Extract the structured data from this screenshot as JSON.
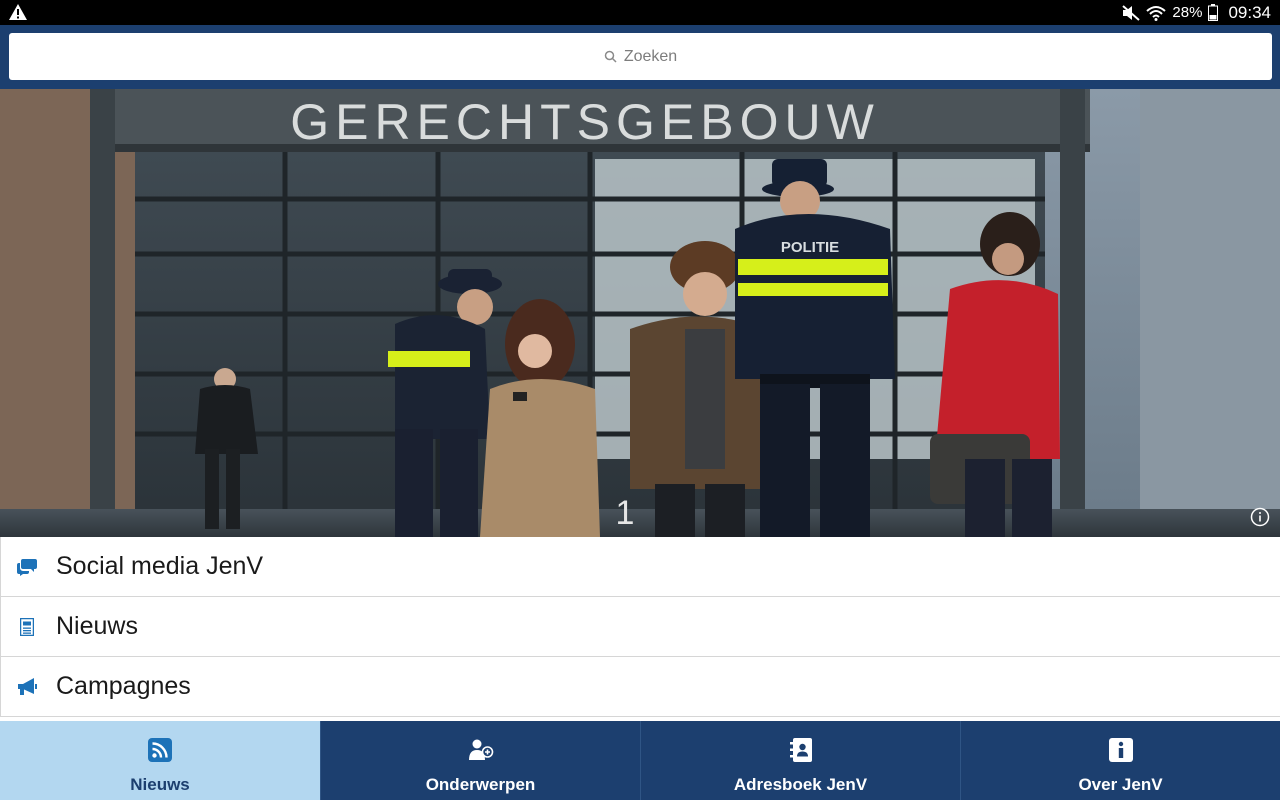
{
  "status_bar": {
    "battery": "28%",
    "time": "09:34",
    "icons": [
      "warning-icon",
      "mute-icon",
      "wifi-icon",
      "battery-icon"
    ]
  },
  "search": {
    "placeholder": "Zoeken"
  },
  "hero": {
    "building_sign": "GERECHTSGEBOUW",
    "vest_text": "POLITIE",
    "door_number": "1"
  },
  "menu": {
    "items": [
      {
        "label": "Social media JenV",
        "icon": "chat-bubbles-icon"
      },
      {
        "label": "Nieuws",
        "icon": "newspaper-icon"
      },
      {
        "label": "Campagnes",
        "icon": "megaphone-icon"
      }
    ]
  },
  "nav": {
    "tabs": [
      {
        "label": "Nieuws",
        "icon": "rss-icon",
        "active": true
      },
      {
        "label": "Onderwerpen",
        "icon": "people-topics-icon",
        "active": false
      },
      {
        "label": "Adresboek JenV",
        "icon": "address-book-icon",
        "active": false
      },
      {
        "label": "Over JenV",
        "icon": "info-icon",
        "active": false
      }
    ]
  },
  "colors": {
    "brand_navy": "#1c3f6f",
    "active_tab": "#b3d7f0",
    "icon_blue": "#1d72b8"
  }
}
